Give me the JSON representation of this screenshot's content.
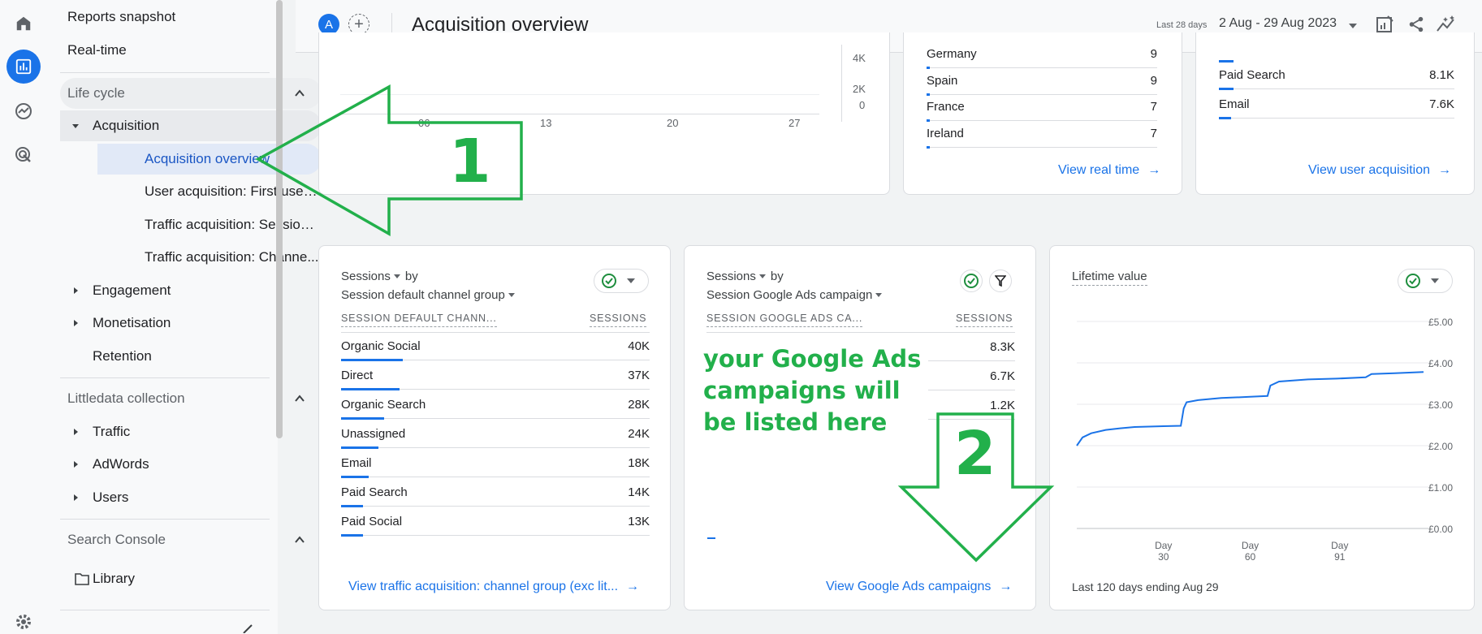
{
  "nav": {
    "top_items": [
      "Reports snapshot",
      "Real-time"
    ],
    "lifecycle_label": "Life cycle",
    "acquisition_label": "Acquisition",
    "acquisition_items": [
      "Acquisition overview",
      "User acquisition: First user ...",
      "Traffic acquisition: Session ...",
      "Traffic acquisition: Channe..."
    ],
    "lifecycle_groups": [
      "Engagement",
      "Monetisation",
      "Retention"
    ],
    "littledata_label": "Littledata collection",
    "littledata_groups": [
      "Traffic",
      "AdWords",
      "Users"
    ],
    "search_console_label": "Search Console",
    "library_label": "Library"
  },
  "header": {
    "avatar_letter": "A",
    "add_symbol": "+",
    "title": "Acquisition overview",
    "date_prefix": "Last 28 days",
    "date_range": "2 Aug - 29 Aug 2023"
  },
  "top_chart": {
    "y_ticks": [
      "4K",
      "2K",
      "0"
    ],
    "x_ticks": [
      "06",
      "13",
      "20",
      "27"
    ]
  },
  "realtime_card": {
    "rows": [
      {
        "label": "Germany",
        "value": "9",
        "fraction": 0.02
      },
      {
        "label": "Spain",
        "value": "9",
        "fraction": 0.02
      },
      {
        "label": "France",
        "value": "7",
        "fraction": 0.02
      },
      {
        "label": "Ireland",
        "value": "7",
        "fraction": 0.02
      }
    ],
    "link": "View real time"
  },
  "user_acq_card": {
    "rows": [
      {
        "label": "Paid Search",
        "value": "8.1K",
        "fraction": 0.07
      },
      {
        "label": "Email",
        "value": "7.6K",
        "fraction": 0.06
      }
    ],
    "link": "View user acquisition"
  },
  "channel_card": {
    "metric": "Sessions",
    "by": "by",
    "dimension": "Session default channel group",
    "col_dim": "SESSION DEFAULT CHANN...",
    "col_metric": "SESSIONS",
    "rows": [
      {
        "label": "Organic Social",
        "value": "40K",
        "fraction": 0.2
      },
      {
        "label": "Direct",
        "value": "37K",
        "fraction": 0.19
      },
      {
        "label": "Organic Search",
        "value": "28K",
        "fraction": 0.14
      },
      {
        "label": "Unassigned",
        "value": "24K",
        "fraction": 0.12
      },
      {
        "label": "Email",
        "value": "18K",
        "fraction": 0.09
      },
      {
        "label": "Paid Search",
        "value": "14K",
        "fraction": 0.07
      },
      {
        "label": "Paid Social",
        "value": "13K",
        "fraction": 0.07
      }
    ],
    "link": "View traffic acquisition: channel group (exc lit..."
  },
  "ads_card": {
    "metric": "Sessions",
    "by": "by",
    "dimension": "Session Google Ads campaign",
    "col_dim": "SESSION GOOGLE ADS CA...",
    "col_metric": "SESSIONS",
    "values": [
      "8.3K",
      "6.7K",
      "1.2K"
    ],
    "link": "View Google Ads campaigns"
  },
  "ltv_card": {
    "title": "Lifetime value",
    "y_ticks": [
      "£5.00",
      "£4.00",
      "£3.00",
      "£2.00",
      "£1.00",
      "£0.00"
    ],
    "x_ticks": [
      {
        "day": "Day",
        "num": "30"
      },
      {
        "day": "Day",
        "num": "60"
      },
      {
        "day": "Day",
        "num": "91"
      }
    ],
    "footer": "Last 120 days ending Aug 29"
  },
  "ltv_chart_data": {
    "type": "line",
    "ylim": [
      0,
      5
    ],
    "xlim": [
      0,
      120
    ],
    "points": [
      [
        0,
        2.0
      ],
      [
        2,
        2.2
      ],
      [
        5,
        2.3
      ],
      [
        10,
        2.38
      ],
      [
        15,
        2.42
      ],
      [
        20,
        2.45
      ],
      [
        25,
        2.46
      ],
      [
        30,
        2.47
      ],
      [
        36,
        2.48
      ],
      [
        37,
        2.9
      ],
      [
        38,
        3.05
      ],
      [
        42,
        3.1
      ],
      [
        50,
        3.15
      ],
      [
        60,
        3.18
      ],
      [
        66,
        3.2
      ],
      [
        67,
        3.45
      ],
      [
        70,
        3.55
      ],
      [
        80,
        3.6
      ],
      [
        90,
        3.62
      ],
      [
        100,
        3.65
      ],
      [
        102,
        3.73
      ],
      [
        110,
        3.75
      ],
      [
        120,
        3.78
      ]
    ]
  },
  "annotations": {
    "arrow1_label": "1",
    "arrow2_label": "2",
    "ads_note": "your Google Ads\ncampaigns will\nbe listed here"
  },
  "colors": {
    "accent": "#1a73e8",
    "annotation": "#22b04b",
    "success": "#1e8e3e"
  }
}
